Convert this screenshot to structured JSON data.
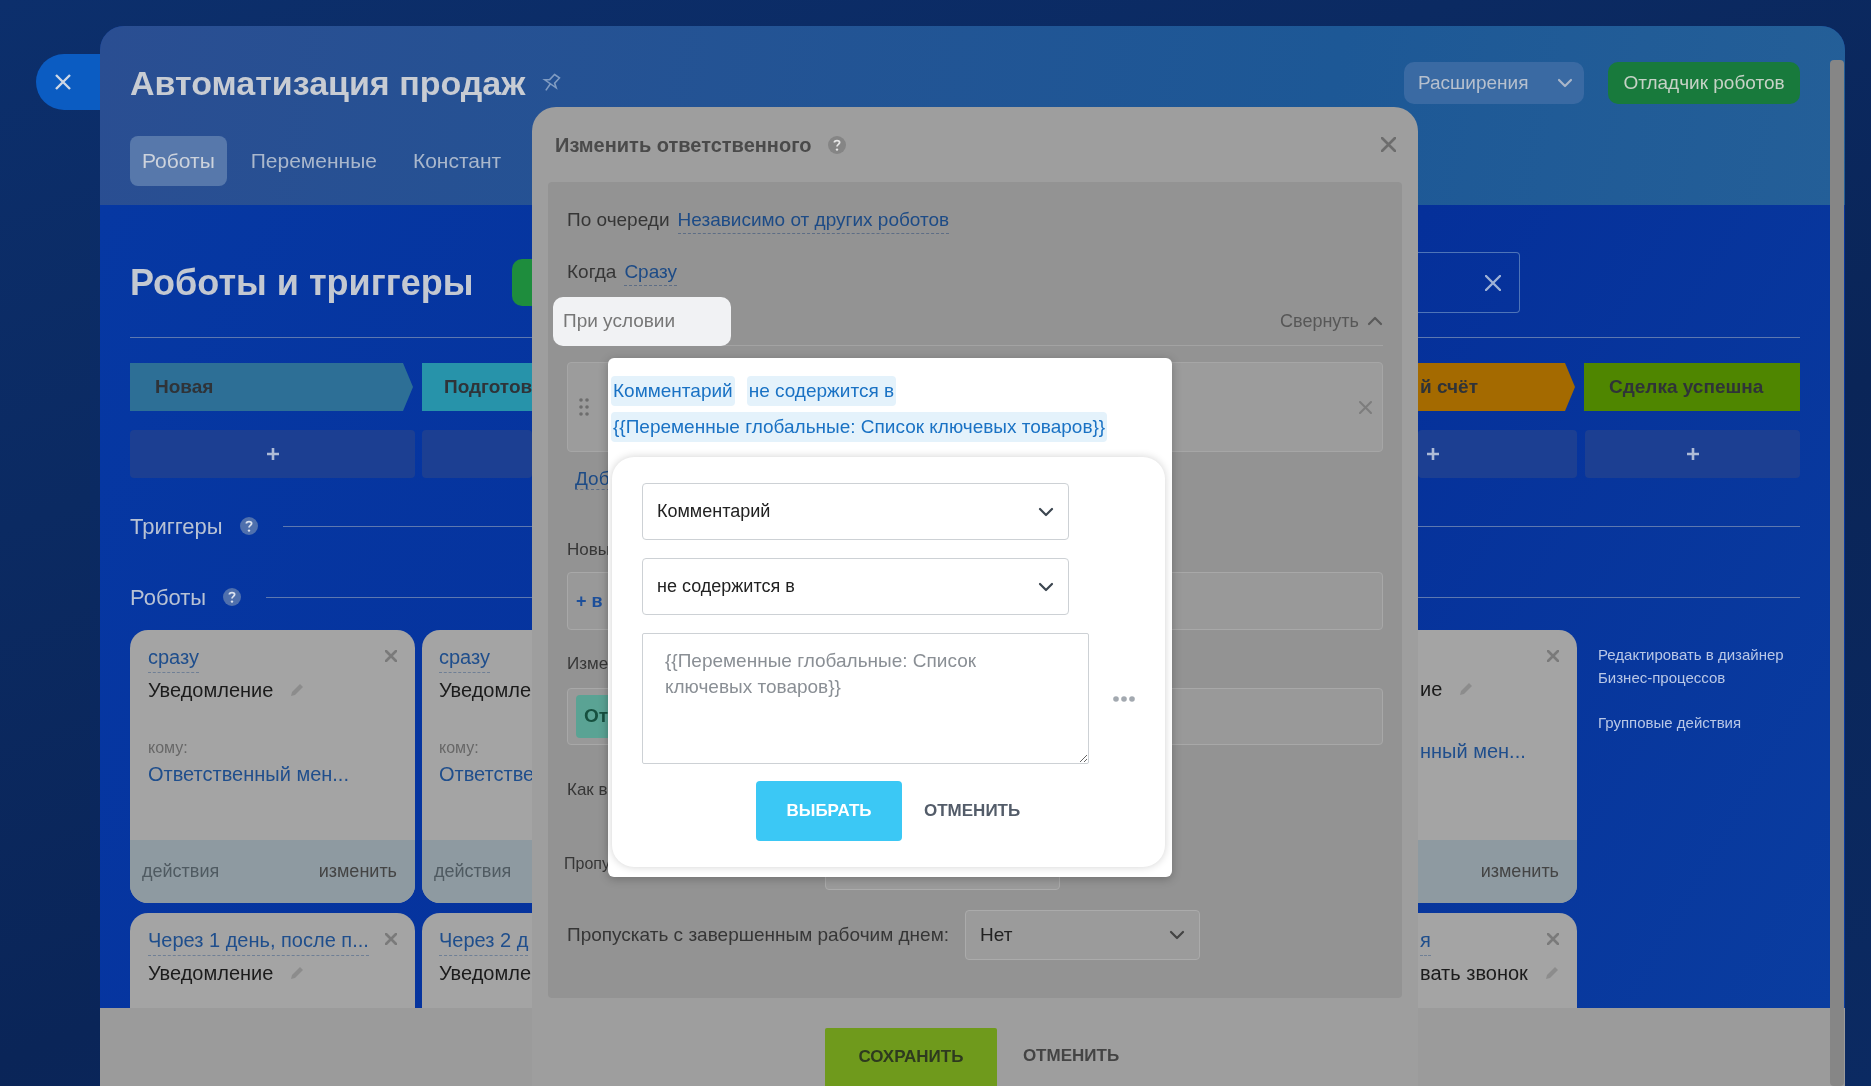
{
  "header": {
    "title": "Автоматизация продаж",
    "tabs": [
      {
        "label": "Роботы",
        "selected": true
      },
      {
        "label": "Переменные",
        "selected": false
      },
      {
        "label": "Констант",
        "selected": false
      }
    ],
    "extensions_button": "Расширения",
    "debugger_button": "Отладчик роботов"
  },
  "section_title": "Роботы и триггеры",
  "stages_left": [
    {
      "label": "Новая",
      "color": "#2d6f96"
    },
    {
      "label": "Подготов",
      "color": "#2793aa"
    }
  ],
  "stages_right": [
    {
      "label": "й счёт",
      "color": "#a46a00"
    },
    {
      "label": "Сделка успешна",
      "color": "#4f8600"
    }
  ],
  "triggers_heading": "Триггеры",
  "robots_heading": "Роботы",
  "robot_cards_left": [
    {
      "when": "сразу",
      "action": "Уведомление",
      "recipient_label": "кому:",
      "recipient": "Ответственный мен...",
      "actions_link": "действия",
      "edit_link": "изменить"
    },
    {
      "when": "сразу",
      "action": "Уведомле",
      "recipient_label": "кому:",
      "recipient": "Ответстве",
      "actions_link": "действия"
    }
  ],
  "robot_card_right": {
    "action": "ие",
    "recipient": "нный мен...",
    "edit_link": "изменить"
  },
  "side_links": [
    {
      "lines": [
        "Редактировать в дизайнер",
        "Бизнес-процессов"
      ]
    },
    {
      "lines": [
        "Групповые действия"
      ]
    }
  ],
  "robot_cards_row2_left": [
    {
      "when": "Через 1 день, после п...",
      "action": "Уведомление"
    },
    {
      "when": "Через 2 д",
      "action": "Уведомле"
    }
  ],
  "robot_card_row2_right": {
    "when": "я",
    "action": "вать звонок"
  },
  "dialog": {
    "title": "Изменить ответственного",
    "queue_label": "По очереди",
    "queue_value": "Независимо от других роботов",
    "when_label": "Когда",
    "when_value": "Сразу",
    "condition_tab": "При условии",
    "collapse": "Свернуть",
    "add_link": "Доб",
    "new_label": "Новы",
    "new_field": "+ в",
    "change_label": "Изме",
    "change_chip": "От",
    "how_label": "Как в",
    "skip_absent_label": "Пропу",
    "skip_done_label": "Пропускать с завершенным рабочим днем:",
    "skip_done_value": "Нет",
    "save_button": "СОХРАНИТЬ",
    "cancel_button": "ОТМЕНИТЬ"
  },
  "condition_popup": {
    "chips": [
      "Комментарий",
      "не содержится в",
      "{{Переменные глобальные: Список ключевых товаров}}"
    ],
    "field_select": "Комментарий",
    "operator_select": "не содержится в",
    "value": "{{Переменные глобальные: Список ключевых товаров}}",
    "select_button": "ВЫБРАТЬ",
    "cancel_button": "ОТМЕНИТЬ"
  }
}
